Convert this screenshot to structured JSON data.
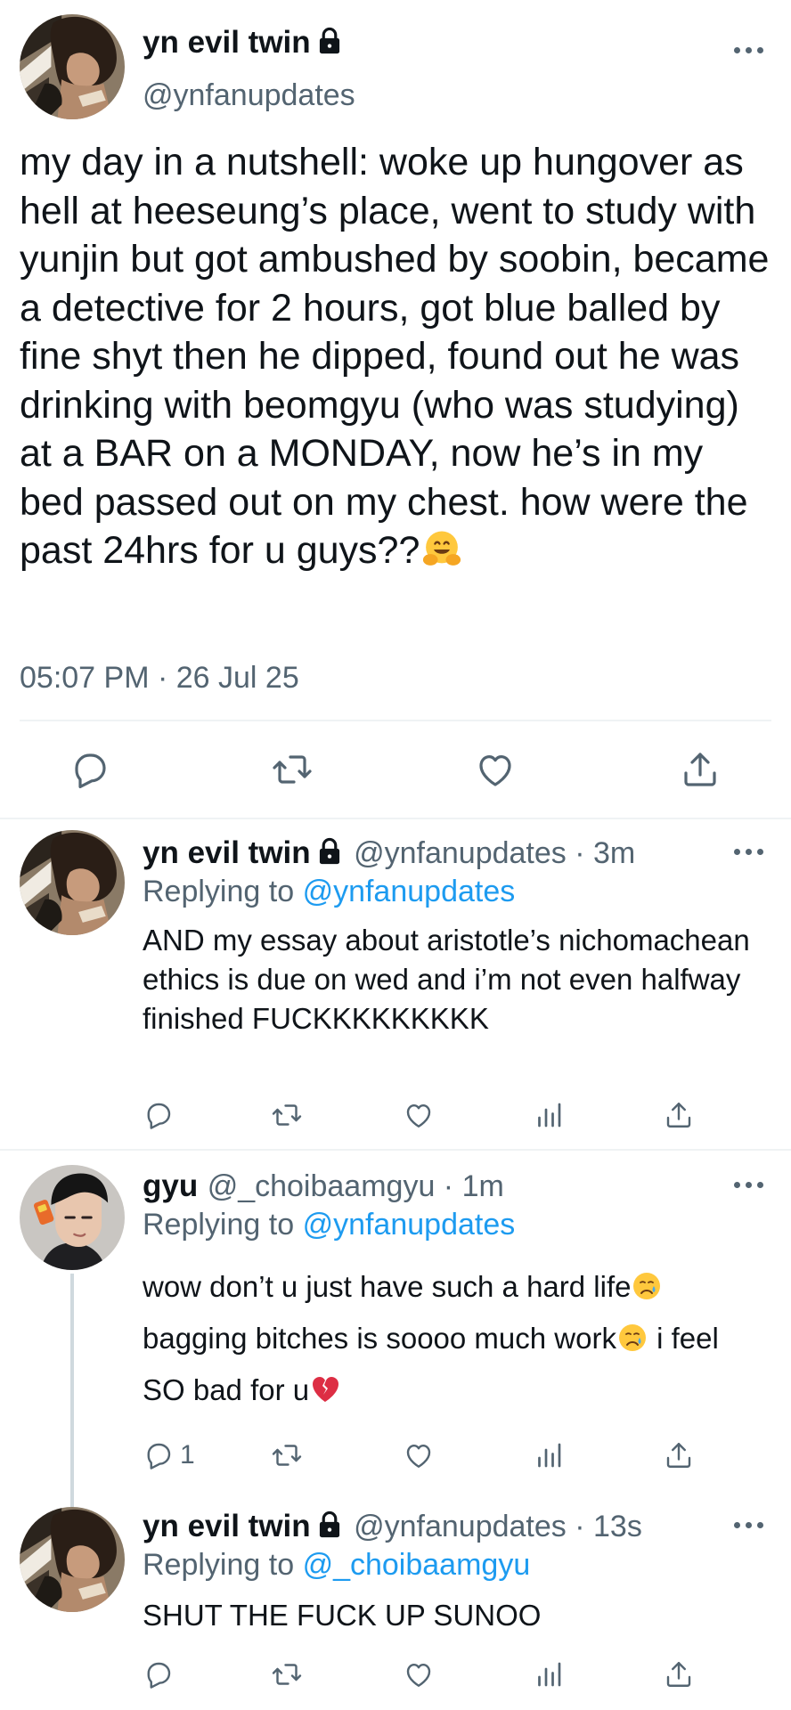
{
  "main_tweet": {
    "display_name": "yn evil twin",
    "handle": "@ynfanupdates",
    "text": "my day in a nutshell: woke up hungover as hell at heeseung’s place, went to study with yunjin but got ambushed by soobin, became a detective for 2 hours, got blue balled by fine shyt then he dipped, found out he was drinking with beomgyu (who was studying) at a BAR on a MONDAY, now he’s in my bed passed out on my chest. how were the past 24hrs for u guys??",
    "emoji_icon": "hugging-face-emoji",
    "timestamp": "05:07 PM · 26 Jul 25",
    "actions": [
      "reply-icon",
      "retweet-icon",
      "like-icon",
      "share-icon"
    ]
  },
  "replies": [
    {
      "display_name": "yn evil twin",
      "handle_time": "@ynfanupdates · 3m",
      "replying_prefix": "Replying to",
      "replying_to": "@ynfanupdates",
      "text": "AND my essay about aristotle’s nichomachean ethics is due on wed and i’m not even halfway finished FUCKKKKKKKKK",
      "locked": true
    },
    {
      "display_name": "gyu",
      "handle_time": "@_choibaamgyu · 1m",
      "replying_prefix": "Replying to",
      "replying_to": "@ynfanupdates",
      "text_a": "wow don’t u just have such a hard life",
      "text_b": " bagging bitches is soooo much work",
      "text_c": " i feel SO bad for u",
      "reply_count": "1",
      "emoji_icons": [
        "crying-face-emoji",
        "crying-face-emoji",
        "broken-heart-emoji"
      ]
    },
    {
      "display_name": "yn evil twin",
      "handle_time": "@ynfanupdates · 13s",
      "replying_prefix": "Replying to",
      "replying_to": "@_choibaamgyu",
      "text": "SHUT THE FUCK UP SUNOO",
      "locked": true
    }
  ],
  "colors": {
    "text": "#0f1419",
    "secondary": "#536471",
    "link": "#1d9bf0",
    "divider": "#eff3f4"
  }
}
